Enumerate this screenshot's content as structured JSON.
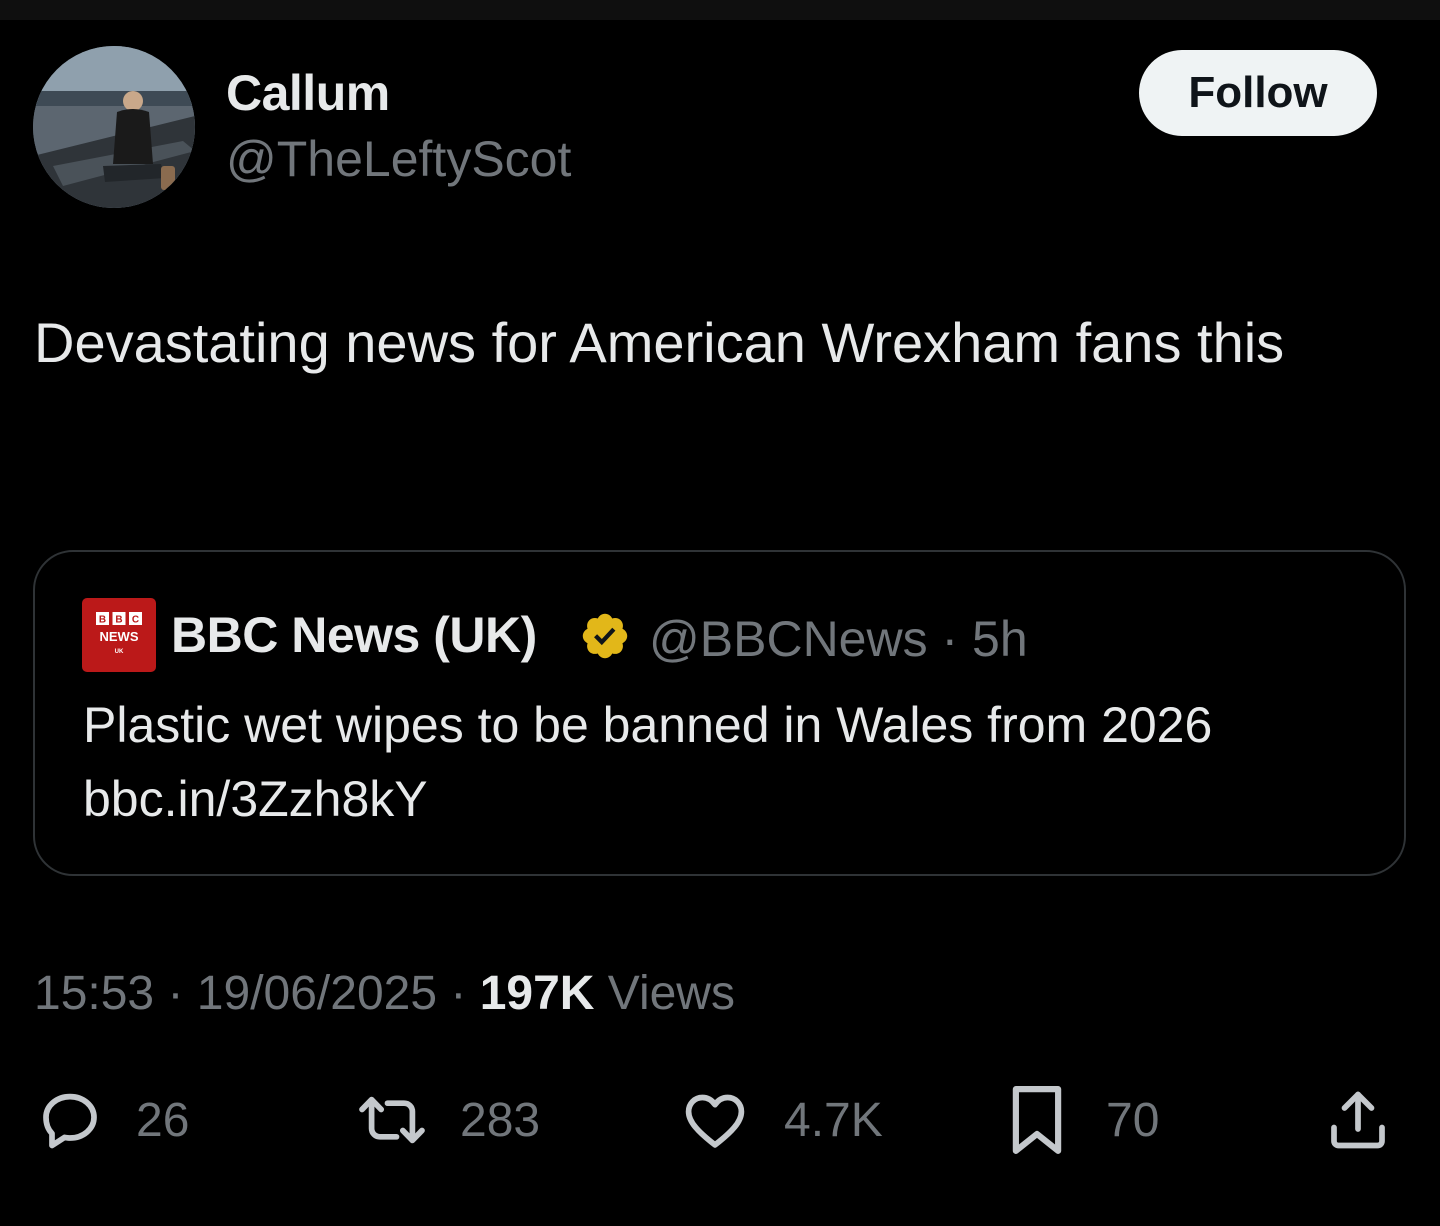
{
  "author": {
    "display_name": "Callum",
    "handle": "@TheLeftyScot",
    "follow_label": "Follow"
  },
  "tweet": {
    "text": "Devastating news for American Wrexham fans this"
  },
  "quote": {
    "logo_lines": [
      "BBC",
      "NEWS",
      "UK"
    ],
    "display_name": "BBC News (UK)",
    "verified_icon": "verified-badge-icon",
    "meta": "@BBCNews · 5h",
    "text_line1": "Plastic wet wipes to be banned in Wales from 2026",
    "text_line2": "bbc.in/3Zzh8kY"
  },
  "meta": {
    "time": "15:53",
    "date": "19/06/2025",
    "separator": "·",
    "views_count": "197K",
    "views_label": "Views"
  },
  "actions": {
    "replies": "26",
    "reposts": "283",
    "likes": "4.7K",
    "bookmarks": "70"
  },
  "colors": {
    "background": "#000000",
    "primary_text": "#e7e9ea",
    "secondary_text": "#71767b",
    "border": "#2f3336",
    "verified_gold": "#e2b719",
    "bbc_red": "#bb1919"
  }
}
